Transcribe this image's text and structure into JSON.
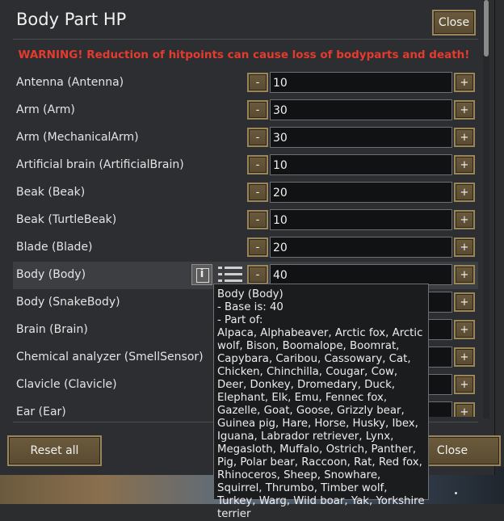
{
  "window": {
    "title": "Body Part HP",
    "close_label": "Close"
  },
  "warning": "WARNING! Reduction of hitpoints can cause loss of bodyparts and death!",
  "stepper": {
    "minus": "-",
    "plus": "+"
  },
  "rows": [
    {
      "label": "Antenna (Antenna)",
      "value": "10"
    },
    {
      "label": "Arm (Arm)",
      "value": "30"
    },
    {
      "label": "Arm (MechanicalArm)",
      "value": "30"
    },
    {
      "label": "Artificial brain (ArtificialBrain)",
      "value": "10"
    },
    {
      "label": "Beak (Beak)",
      "value": "20"
    },
    {
      "label": "Beak (TurtleBeak)",
      "value": "10"
    },
    {
      "label": "Blade (Blade)",
      "value": "20"
    },
    {
      "label": "Body (Body)",
      "value": "40"
    },
    {
      "label": "Body (SnakeBody)",
      "value": ""
    },
    {
      "label": "Brain (Brain)",
      "value": ""
    },
    {
      "label": "Chemical analyzer (SmellSensor)",
      "value": ""
    },
    {
      "label": "Clavicle (Clavicle)",
      "value": ""
    },
    {
      "label": "Ear (Ear)",
      "value": ""
    }
  ],
  "row_icons": {
    "info": "info-icon",
    "list": "list-icon",
    "info_glyph": "i"
  },
  "tooltip": {
    "title": "Body (Body)",
    "base": "- Base is: 40",
    "part_of_label": "- Part of:",
    "animals": "Alpaca, Alphabeaver, Arctic fox, Arctic wolf, Bison, Boomalope, Boomrat, Capybara, Caribou, Cassowary, Cat, Chicken, Chinchilla, Cougar, Cow, Deer, Donkey, Dromedary, Duck, Elephant, Elk, Emu, Fennec fox, Gazelle, Goat, Goose, Grizzly bear, Guinea pig, Hare, Horse, Husky, Ibex, Iguana, Labrador retriever, Lynx, Megasloth, Muffalo, Ostrich, Panther, Pig, Polar bear, Raccoon, Rat, Red fox, Rhinoceros, Sheep, Snowhare, Squirrel, Thrumbo, Timber wolf, Turkey, Warg, Wild boar, Yak, Yorkshire terrier"
  },
  "footer": {
    "reset_label": "Reset all",
    "close_label": "Close"
  },
  "colors": {
    "warning": "#e53b2e",
    "button": "#5a4b31",
    "button_border": "#9b865c",
    "panel": "#2c2e31"
  }
}
